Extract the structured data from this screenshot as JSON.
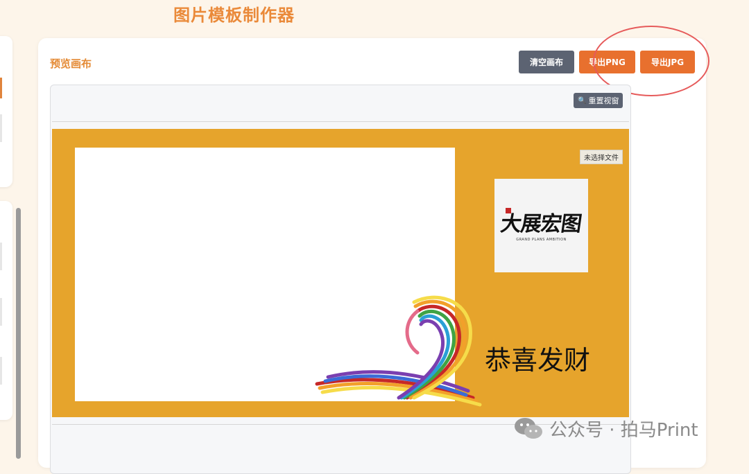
{
  "app": {
    "title": "图片模板制作器"
  },
  "preview": {
    "section_title": "预览画布",
    "buttons": {
      "clear": "清空画布",
      "export_png": "导出PNG",
      "export_jpg": "导出JPG"
    },
    "reset_view": "重置视窗"
  },
  "canvas": {
    "background_color": "#e6a42c",
    "file_status": "未选择文件",
    "logo_text": "大展宏图",
    "logo_subtitle": "GRAND PLANS AMBITION",
    "greeting": "恭喜发财"
  },
  "watermark": {
    "text": "公众号 · 拍马Print"
  },
  "colors": {
    "accent": "#e8702e",
    "title": "#ea8a3a",
    "clear_button": "#5c6372",
    "highlight": "#e65a5a"
  }
}
